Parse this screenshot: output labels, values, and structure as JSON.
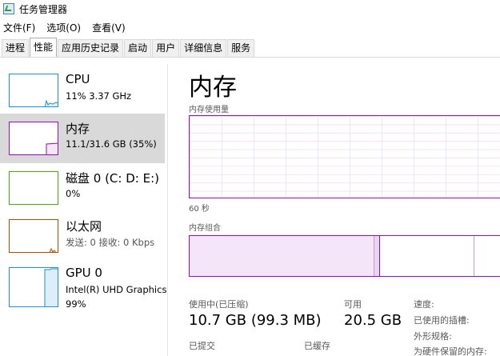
{
  "window": {
    "title": "任务管理器"
  },
  "menu": [
    "文件(F)",
    "选项(O)",
    "查看(V)"
  ],
  "tabs": [
    {
      "label": "进程",
      "active": false
    },
    {
      "label": "性能",
      "active": true
    },
    {
      "label": "应用历史记录",
      "active": false
    },
    {
      "label": "启动",
      "active": false
    },
    {
      "label": "用户",
      "active": false
    },
    {
      "label": "详细信息",
      "active": false
    },
    {
      "label": "服务",
      "active": false
    }
  ],
  "sidebar": {
    "items": [
      {
        "name": "CPU",
        "sub": "11%  3.37 GHz",
        "color": "#1e8fcf",
        "selected": false
      },
      {
        "name": "内存",
        "sub": "11.1/31.6 GB (35%)",
        "color": "#8b12ae",
        "selected": true
      },
      {
        "name": "磁盘 0 (C: D: E:)",
        "sub": "0%",
        "color": "#4da60c",
        "selected": false
      },
      {
        "name": "以太网",
        "sub": "发送: 0 接收: 0 Kbps",
        "color": "#a74f01",
        "selected": false
      },
      {
        "name": "GPU 0",
        "sub": "Intel(R) UHD Graphics",
        "sub2": "99%",
        "color": "#1e8fcf",
        "selected": false
      }
    ]
  },
  "main": {
    "title": "内存",
    "usage_label": "内存使用量",
    "time_label": "60 秒",
    "composition_label": "内存组合",
    "stats": {
      "in_use_label": "使用中(已压缩)",
      "in_use_value": "10.7 GB (99.3 MB)",
      "available_label": "可用",
      "available_value": "20.5 GB",
      "committed_label": "已提交",
      "cached_label": "已缓存",
      "speed_label": "速度:",
      "slots_label": "已使用的插槽:",
      "form_factor_label": "外形规格:",
      "hardware_reserved_label": "为硬件保留的内存:"
    }
  },
  "colors": {
    "memory": "#8b12ae",
    "cpu": "#1e8fcf",
    "disk": "#4da60c",
    "ethernet": "#a74f01"
  }
}
